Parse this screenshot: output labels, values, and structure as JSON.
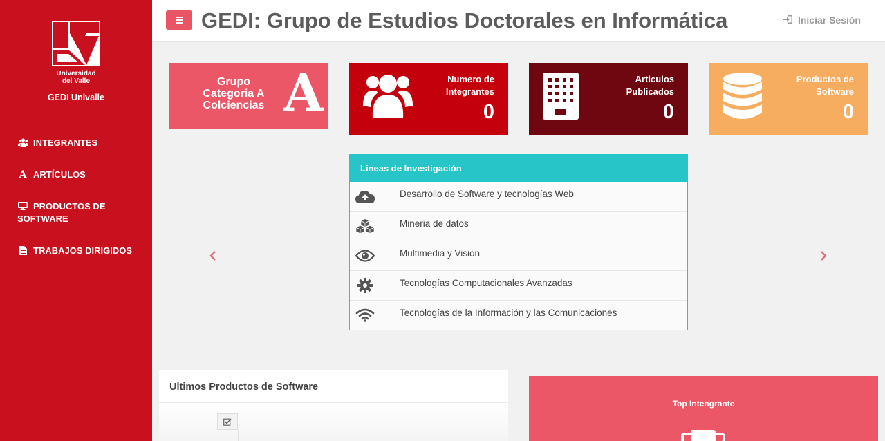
{
  "sidebar": {
    "logo_line1": "Universidad",
    "logo_line2": "del Valle",
    "group_name": "GEDI Univalle",
    "items": [
      {
        "label": "INTEGRANTES",
        "icon": "users-icon"
      },
      {
        "label": "ARTÍCULOS",
        "icon": "font-icon"
      },
      {
        "label": "PRODUCTOS DE",
        "label2": "SOFTWARE",
        "icon": "desktop-icon"
      },
      {
        "label": "TRABAJOS DIRIGIDOS",
        "icon": "file-icon"
      }
    ]
  },
  "header": {
    "title": "GEDI: Grupo de Estudios Doctorales en Informática",
    "login": "Iniciar Sesión"
  },
  "stats": [
    {
      "label_lines": [
        "Grupo",
        "Categoria A",
        "Colciencias"
      ],
      "glyph": "A",
      "color": "#ec5768"
    },
    {
      "label_lines": [
        "Numero de",
        "Integrantes"
      ],
      "value": "0",
      "icon": "users-icon",
      "color": "#c4000d"
    },
    {
      "label_lines": [
        "Articulos",
        "Publicados"
      ],
      "value": "0",
      "icon": "building-icon",
      "color": "#6e0710"
    },
    {
      "label_lines": [
        "Productos de",
        "Software"
      ],
      "value": "0",
      "icon": "database-icon",
      "color": "#f6ad5f"
    }
  ],
  "research": {
    "title": "Lineas de Investigación",
    "lines": [
      {
        "label": "Desarrollo de Software y tecnologías Web",
        "icon": "cloud-upload-icon"
      },
      {
        "label": "Mineria de datos",
        "icon": "cubes-icon"
      },
      {
        "label": "Multimedia y Visión",
        "icon": "eye-icon"
      },
      {
        "label": "Tecnologías Computacionales Avanzadas",
        "icon": "gear-icon"
      },
      {
        "label": "Tecnologías de la Información y las Comunicaciones",
        "icon": "wifi-icon"
      }
    ]
  },
  "products": {
    "title": "Ultimos Productos de Software"
  },
  "top_member": {
    "title": "Top Intengrante",
    "icon": "trophy-icon"
  }
}
